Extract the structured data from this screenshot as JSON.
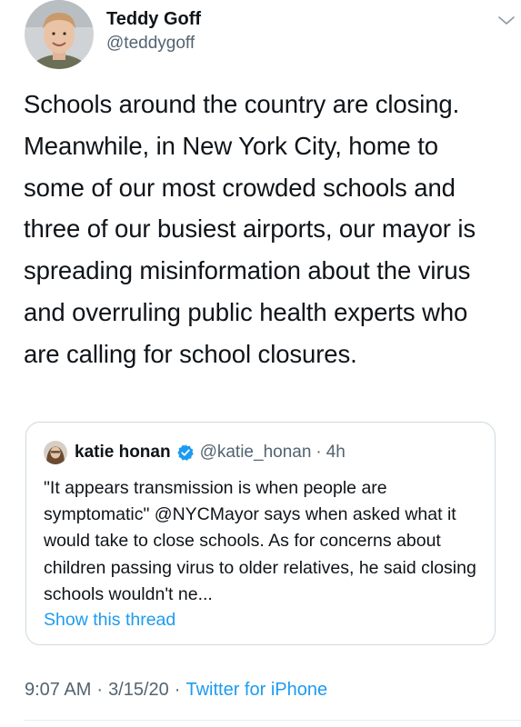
{
  "author": {
    "display_name": "Teddy Goff",
    "handle": "@teddygoff",
    "avatar_icon": "profile-photo"
  },
  "tweet": {
    "text": "Schools around the country are closing. Meanwhile, in New York City, home to some of our most crowded schools and three of our busiest airports, our mayor is spreading misinformation about the virus and overruling public health experts who are calling for school closures."
  },
  "quoted_tweet": {
    "display_name": "katie honan",
    "handle": "@katie_honan",
    "separator": "·",
    "time": "4h",
    "verified": true,
    "text": "\"It appears transmission is when people are symptomatic\" @NYCMayor says when asked what it would take to close schools. As for concerns about children passing virus to older relatives, he said closing schools wouldn't ne...",
    "show_thread_label": "Show this thread"
  },
  "meta": {
    "time": "9:07 AM",
    "date": "3/15/20",
    "separator": "·",
    "source": "Twitter for iPhone"
  },
  "colors": {
    "link_blue": "#1d9bf0",
    "secondary_text": "#536471",
    "border": "#cfd9de"
  }
}
